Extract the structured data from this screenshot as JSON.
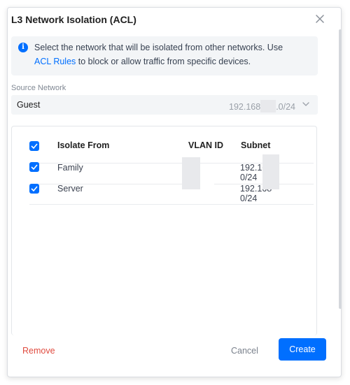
{
  "dialog": {
    "title": "L3 Network Isolation (ACL)",
    "close_icon": "close-icon"
  },
  "info": {
    "icon": "info-icon",
    "text_before": "Select the network that will be isolated from other networks. Use",
    "link_text": "ACL Rules",
    "text_after": " to block or allow traffic from specific devices."
  },
  "source": {
    "label": "Source Network",
    "network_name": "Guest",
    "subnet_prefix": "192.168",
    "subnet_suffix": ".0/24",
    "chevron_icon": "chevron-down-icon"
  },
  "table": {
    "headers": {
      "isolate_from": "Isolate From",
      "vlan_id": "VLAN ID",
      "subnet": "Subnet"
    },
    "rows": [
      {
        "name": "Family",
        "checked": true,
        "subnet_prefix": "192.168",
        "subnet_suffix": "0/24"
      },
      {
        "name": "Server",
        "checked": true,
        "subnet_prefix": "192.168",
        "subnet_suffix": "0/24"
      }
    ]
  },
  "footer": {
    "remove_label": "Remove",
    "cancel_label": "Cancel",
    "create_label": "Create"
  },
  "colors": {
    "accent": "#006fff",
    "danger": "#e04b3f",
    "muted": "#7a818c"
  }
}
